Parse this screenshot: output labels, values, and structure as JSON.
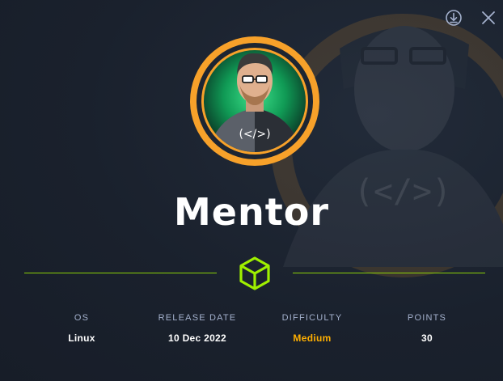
{
  "machine": {
    "name": "Mentor",
    "avatar_badge": "(</>)"
  },
  "toolbar": {
    "download_icon": "download-circle-icon",
    "close_icon": "close-icon"
  },
  "stats": [
    {
      "label": "OS",
      "value": "Linux"
    },
    {
      "label": "RELEASE DATE",
      "value": "10 Dec 2022"
    },
    {
      "label": "DIFFICULTY",
      "value": "Medium"
    },
    {
      "label": "POINTS",
      "value": "30"
    }
  ],
  "colors": {
    "accent_green": "#9fef00",
    "difficulty_medium": "#ffaf00",
    "ring_orange": "#f7a12a",
    "label_gray": "#a4b1cd"
  }
}
